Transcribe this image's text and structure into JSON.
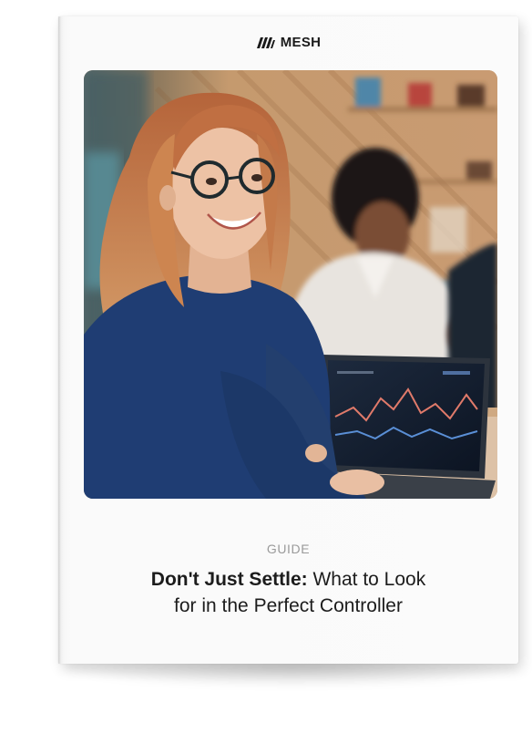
{
  "brand": {
    "name": "MESH",
    "icon": "mesh-logo-icon"
  },
  "cover": {
    "label": "GUIDE",
    "title_bold": "Don't Just Settle:",
    "title_rest": "What to Look",
    "title_line2": "for in the Perfect Controller"
  },
  "colors": {
    "background": "#ffffff",
    "page": "#fafafa",
    "label": "#9a9a9a",
    "title": "#1c1c1c"
  }
}
